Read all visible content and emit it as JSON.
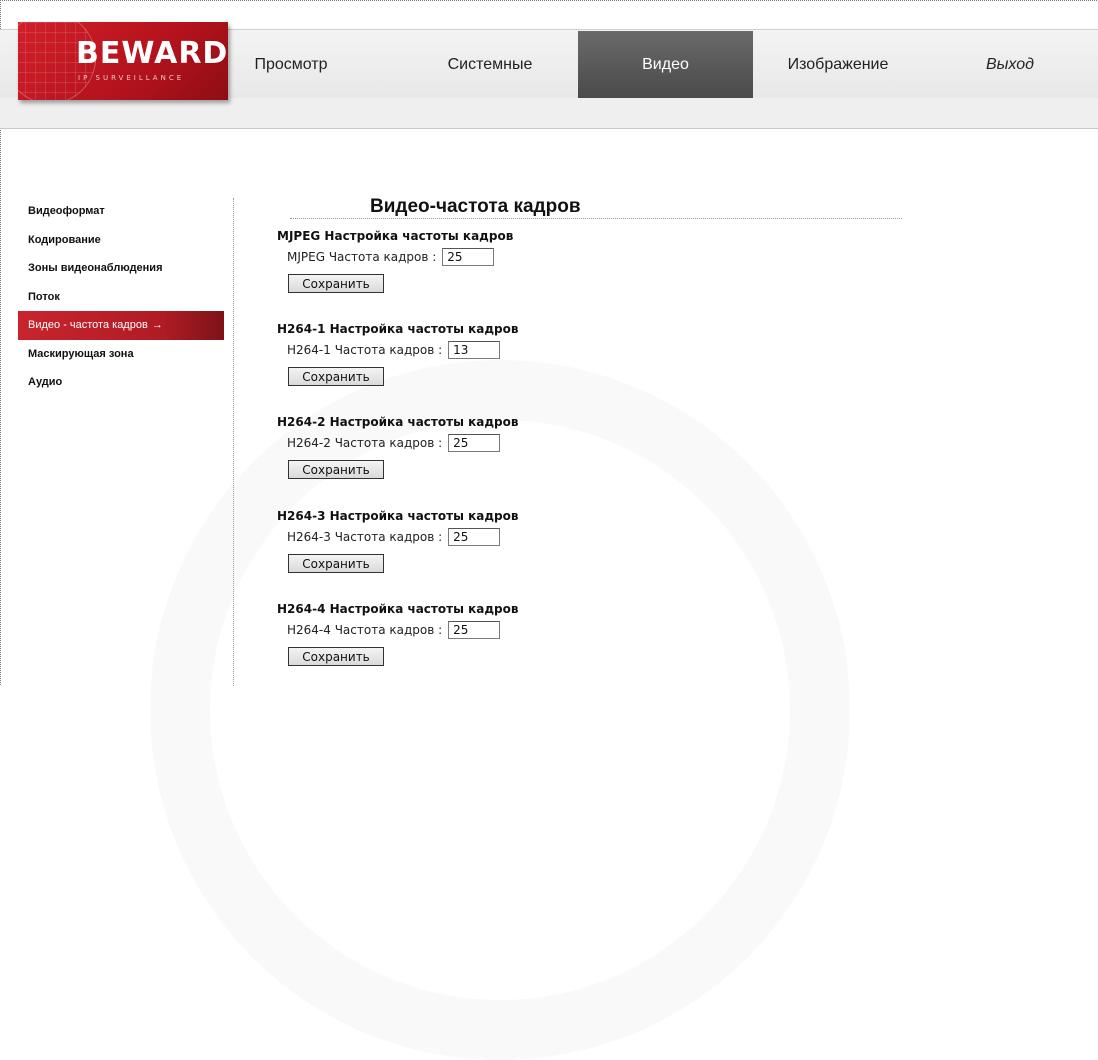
{
  "brand": {
    "logo_text": "BEWARD",
    "logo_subtext": "IP SURVEILLANCE"
  },
  "nav": {
    "items": [
      {
        "label": "Просмотр"
      },
      {
        "label": "Системные"
      },
      {
        "label": "Видео"
      },
      {
        "label": "Изображение"
      },
      {
        "label": "Выход"
      }
    ],
    "active": "Видео"
  },
  "sidebar": {
    "items": [
      {
        "label": "Видеоформат"
      },
      {
        "label": "Кодирование"
      },
      {
        "label": "Зоны видеонаблюдения"
      },
      {
        "label": "Поток"
      },
      {
        "label": "Видео - частота кадров"
      },
      {
        "label": "Маскирующая зона"
      },
      {
        "label": "Аудио"
      }
    ],
    "active_arrow": "→"
  },
  "main": {
    "title": "Видео-частота кадров",
    "sections": [
      {
        "title": "MJPEG Настройка частоты кадров",
        "field_label": "MJPEG Частота кадров :",
        "value": "25",
        "button": "Сохранить"
      },
      {
        "title": "H264-1 Настройка частоты кадров",
        "field_label": "H264-1 Частота кадров :",
        "value": "13",
        "button": "Сохранить"
      },
      {
        "title": "H264-2 Настройка частоты кадров",
        "field_label": "H264-2 Частота кадров :",
        "value": "25",
        "button": "Сохранить"
      },
      {
        "title": "H264-3 Настройка частоты кадров",
        "field_label": "H264-3 Частота кадров :",
        "value": "25",
        "button": "Сохранить"
      },
      {
        "title": "H264-4 Настройка частоты кадров",
        "field_label": "H264-4 Частота кадров :",
        "value": "25",
        "button": "Сохранить"
      }
    ]
  },
  "colors": {
    "accent_red": "#c9242d",
    "active_tab": "#555555"
  }
}
